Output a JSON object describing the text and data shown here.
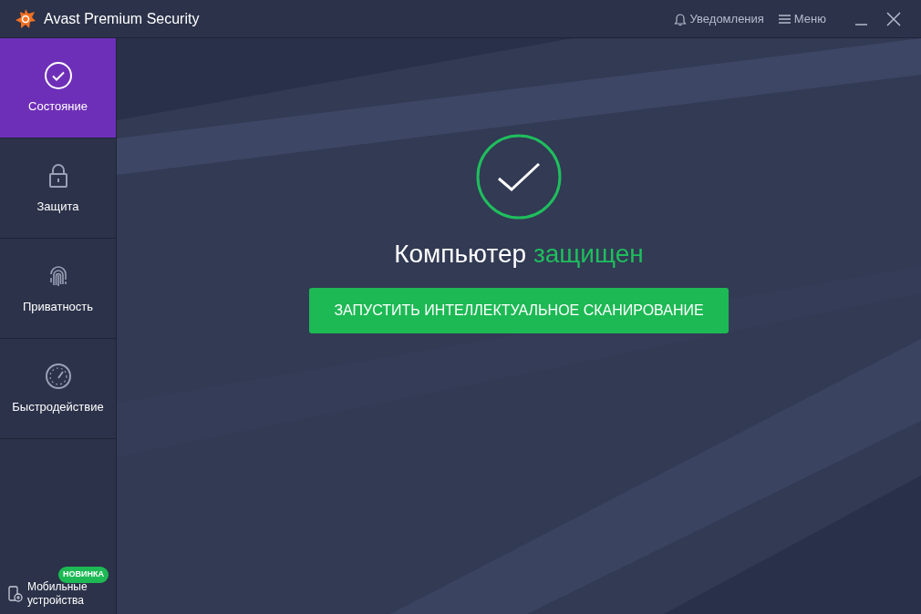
{
  "window": {
    "title": "Avast Premium Security"
  },
  "header_links": [
    {
      "kind": "bell",
      "label": "Уведомления"
    },
    {
      "kind": "menu",
      "label": "Меню"
    }
  ],
  "sidebar": {
    "items": [
      {
        "kind": "check",
        "label": "Состояние",
        "selected": true
      },
      {
        "kind": "lock",
        "label": "Защита",
        "selected": false
      },
      {
        "kind": "fingerprint",
        "label": "Приватность",
        "selected": false
      },
      {
        "kind": "gauge",
        "label": "Быстродействие",
        "selected": false
      }
    ],
    "mobile": {
      "label": "Мобильные устройства",
      "badge": "НОВИНКА"
    }
  },
  "status": {
    "heading": "Компьютер **защищен**",
    "button": "ЗАПУСТИТЬ ИНТЕЛЛЕКТУАЛЬНОЕ СКАНИРОВАНИЕ"
  }
}
